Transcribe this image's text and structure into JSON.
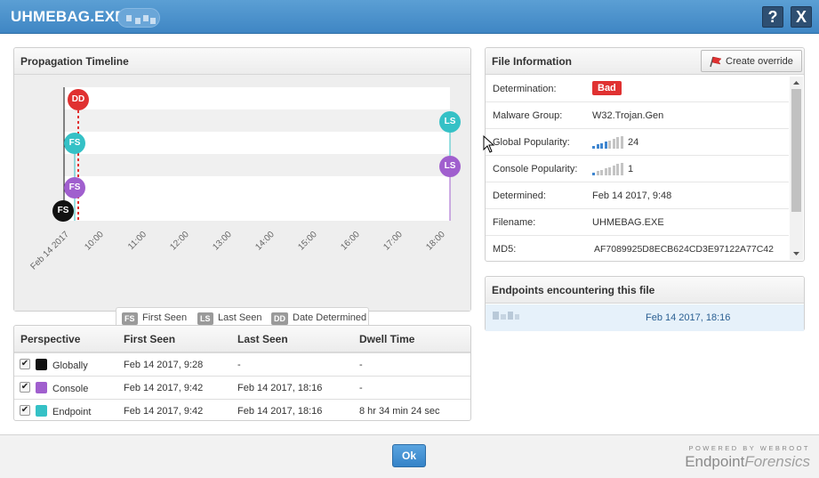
{
  "window": {
    "title": "UHMEBAG.EXE",
    "help_label": "?",
    "close_label": "X"
  },
  "timeline": {
    "title": "Propagation Timeline",
    "axis_labels": [
      "Feb 14 2017",
      "10:00",
      "11:00",
      "12:00",
      "13:00",
      "14:00",
      "15:00",
      "16:00",
      "17:00",
      "18:00"
    ],
    "markers": {
      "dd": "DD",
      "fs": "FS",
      "ls": "LS"
    },
    "legend": [
      {
        "code": "FS",
        "label": "First Seen"
      },
      {
        "code": "LS",
        "label": "Last Seen"
      },
      {
        "code": "DD",
        "label": "Date Determined"
      }
    ],
    "colors": {
      "global": "#111111",
      "console": "#a05fce",
      "endpoint": "#35c1c6",
      "determined": "#e03131"
    }
  },
  "perspective": {
    "headers": [
      "Perspective",
      "First Seen",
      "Last Seen",
      "Dwell Time"
    ],
    "rows": [
      {
        "name": "Globally",
        "first_seen": "Feb 14 2017, 9:28",
        "last_seen": "-",
        "dwell": "-",
        "color": "#111111",
        "checked": "✔"
      },
      {
        "name": "Console",
        "first_seen": "Feb 14 2017, 9:42",
        "last_seen": "Feb 14 2017, 18:16",
        "dwell": "-",
        "color": "#a05fce",
        "checked": "✔"
      },
      {
        "name": "Endpoint",
        "first_seen": "Feb 14 2017, 9:42",
        "last_seen": "Feb 14 2017, 18:16",
        "dwell": "8 hr 34 min 24 sec",
        "color": "#35c1c6",
        "checked": "✔"
      }
    ]
  },
  "file_info": {
    "title": "File Information",
    "override_label": "Create override",
    "rows": [
      {
        "key": "Determination:",
        "value": "Bad"
      },
      {
        "key": "Malware Group:",
        "value": "W32.Trojan.Gen"
      },
      {
        "key": "Global Popularity:",
        "value": "24"
      },
      {
        "key": "Console Popularity:",
        "value": "1"
      },
      {
        "key": "Determined:",
        "value": "Feb 14 2017, 9:48"
      },
      {
        "key": "Filename:",
        "value": "UHMEBAG.EXE"
      },
      {
        "key": "MD5:",
        "value": "AF7089925D8ECB624CD3E97122A77C42"
      }
    ],
    "global_popularity_level": 4,
    "console_popularity_level": 1,
    "popularity_max": 8
  },
  "endpoints": {
    "title": "Endpoints encountering this file",
    "rows": [
      {
        "date": "Feb 14 2017, 18:16"
      }
    ]
  },
  "footer": {
    "ok_label": "Ok",
    "brand_powered": "POWERED BY WEBROOT",
    "brand_main": "Endpoint",
    "brand_sub": "Forensics"
  }
}
